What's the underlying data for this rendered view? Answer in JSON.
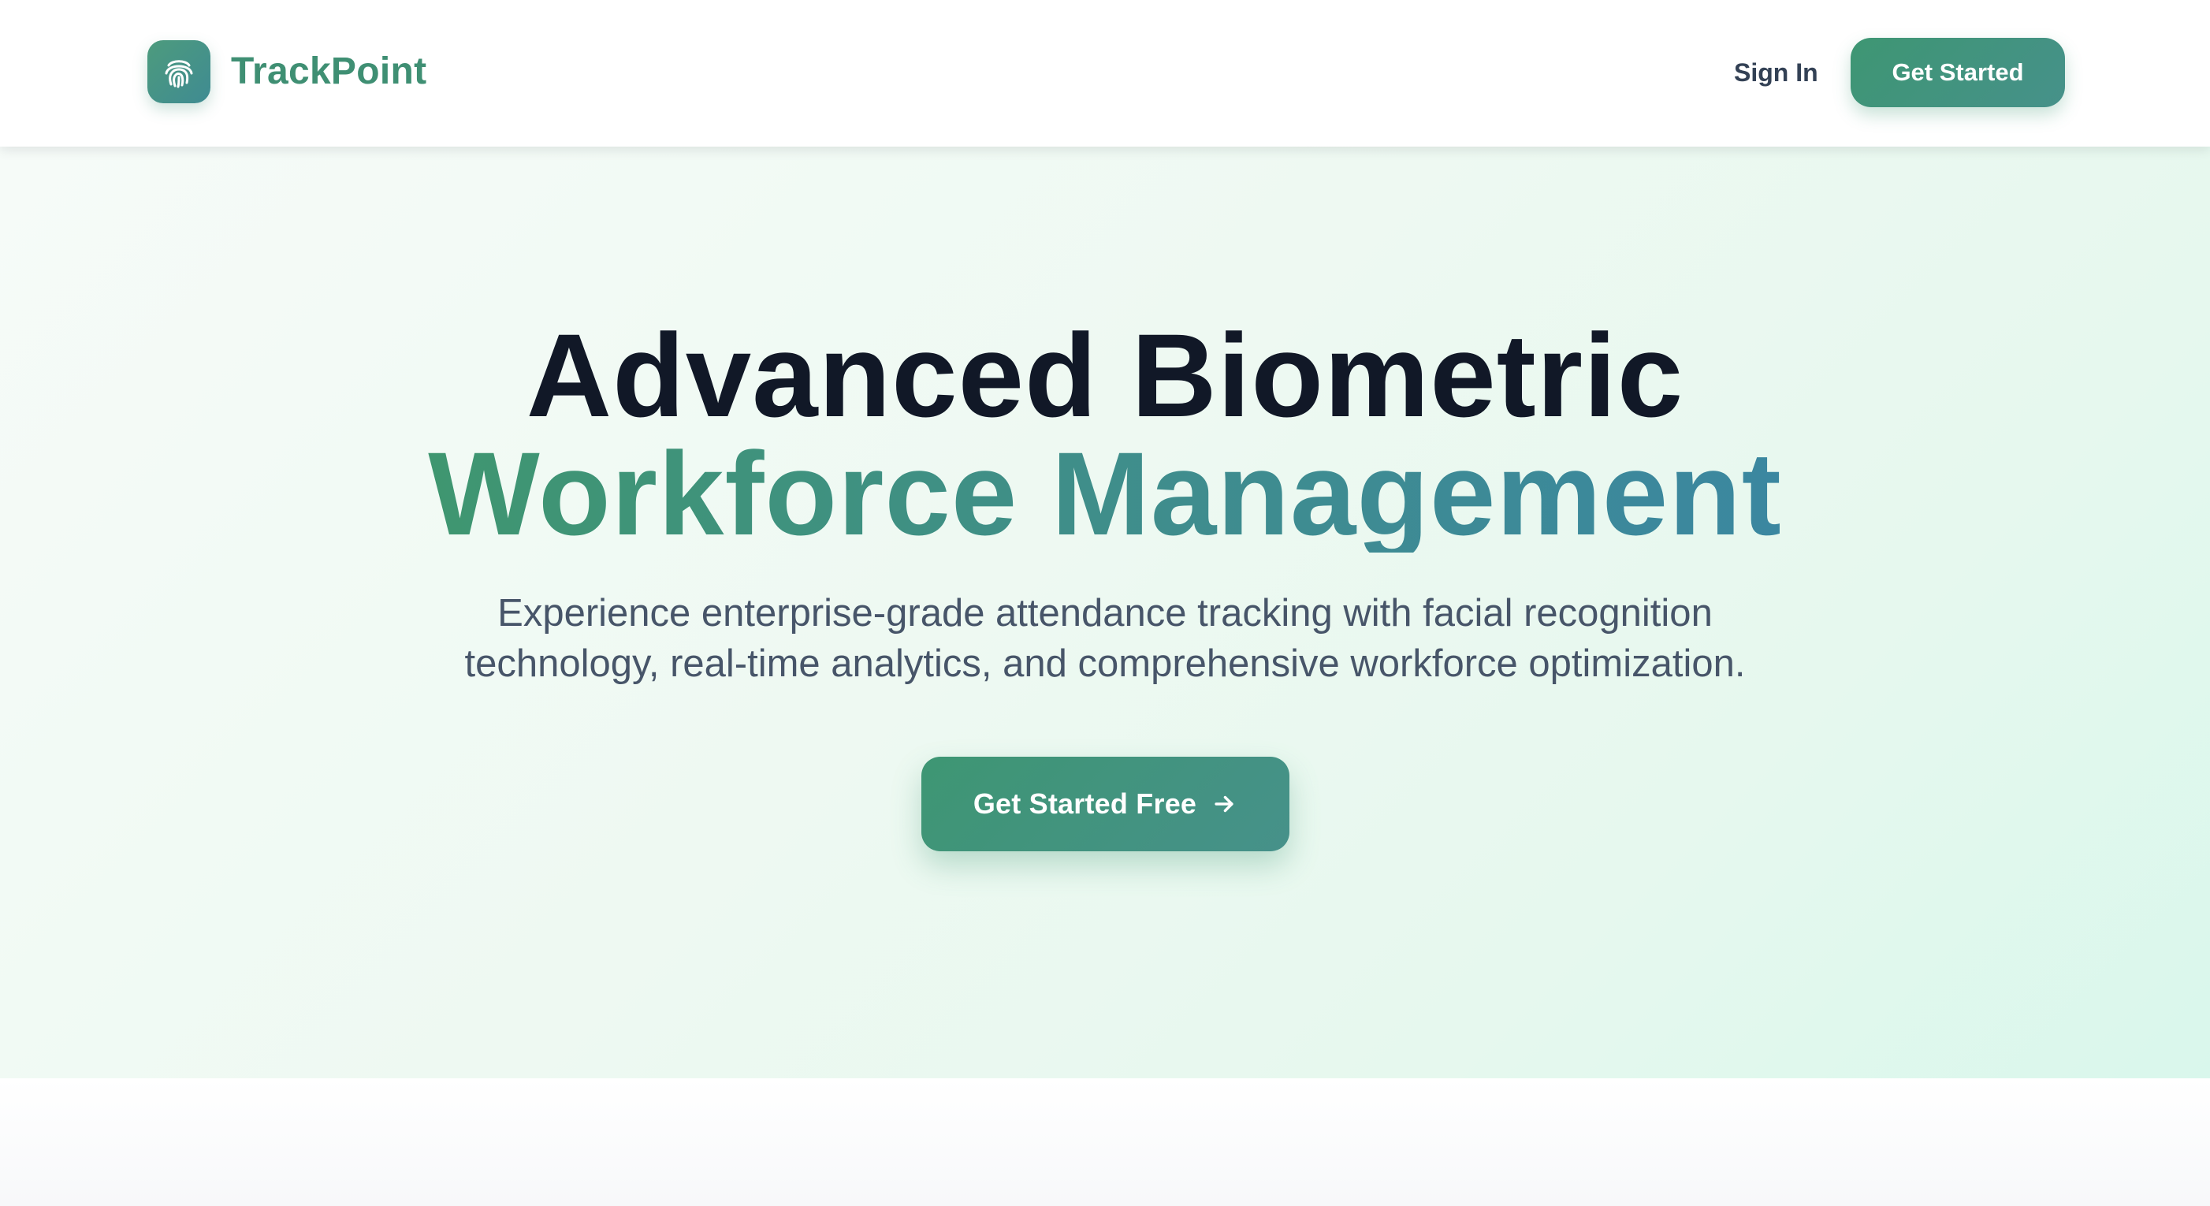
{
  "brand": {
    "name": "TrackPoint",
    "icon": "fingerprint-icon"
  },
  "nav": {
    "sign_in_label": "Sign In",
    "cta_label": "Get Started"
  },
  "hero": {
    "title_line1": "Advanced Biometric",
    "title_line2": "Workforce Management",
    "subtitle_line1": "Experience enterprise-grade attendance tracking with facial recognition",
    "subtitle_line2": "technology, real-time analytics, and comprehensive workforce optimization.",
    "cta_label": "Get Started Free",
    "cta_icon": "arrow-right-icon"
  },
  "colors": {
    "brand_green": "#3f8f73",
    "gradient_start": "#3e9673",
    "gradient_end": "#46918a",
    "heading_dark": "#111827",
    "body_text": "#475569",
    "hero_background": "#e6f8ee"
  }
}
